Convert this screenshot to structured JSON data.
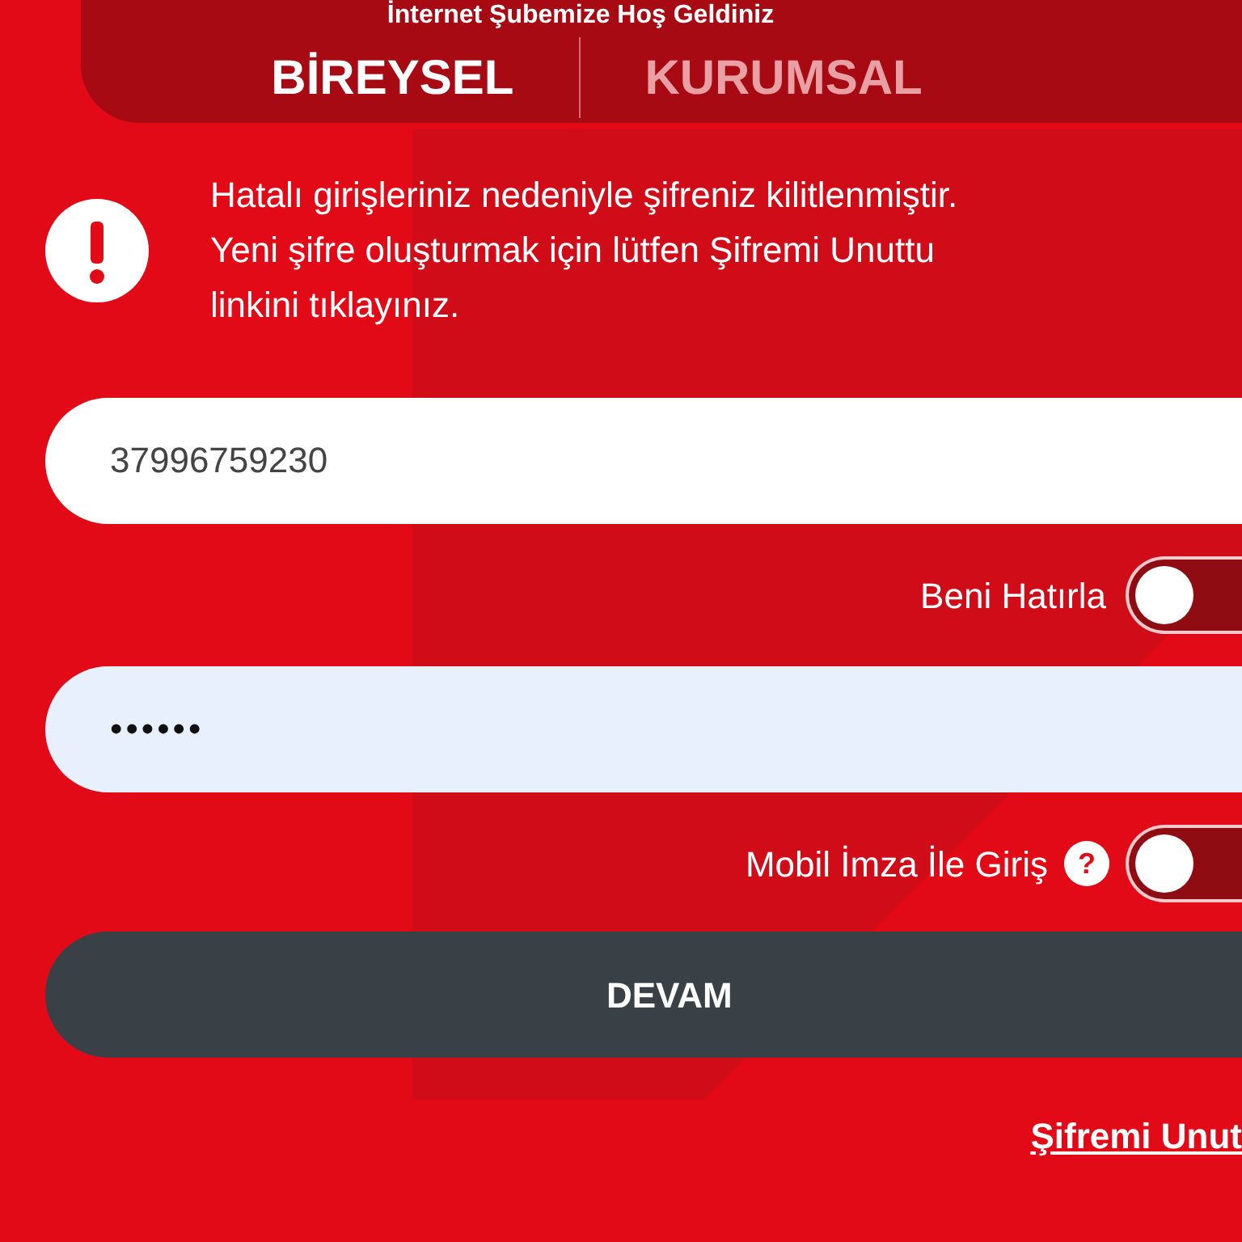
{
  "heading": "İnternet Şubemize Hoş Geldiniz",
  "tabs": [
    {
      "label": "BİREYSEL",
      "selected": true
    },
    {
      "label": "KURUMSAL",
      "selected": false
    }
  ],
  "alert": {
    "text": "Hatalı girişleriniz nedeniyle şifreniz kilitlenmiştir.\nYeni şifre oluşturmak için lütfen Şifremi Unuttu\nlinkini tıklayınız."
  },
  "customer_field": {
    "value": "37996759230"
  },
  "remember_me": {
    "label": "Beni Hatırla",
    "on": false
  },
  "password_field": {
    "value": "••••••"
  },
  "mobile_signature": {
    "label": "Mobil İmza İle Giriş",
    "help": "?",
    "on": false
  },
  "continue_button": {
    "label": "DEVAM"
  },
  "forgot_link": {
    "label": "Şifremi Unut"
  }
}
